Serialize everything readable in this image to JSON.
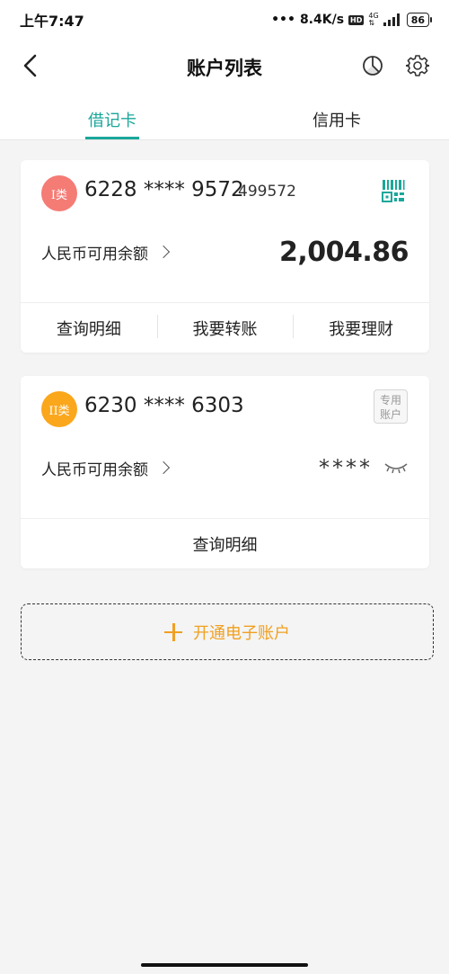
{
  "status_bar": {
    "time": "上午7:47",
    "network_speed": "8.4K/s",
    "hd": "HD",
    "network": "4G",
    "battery": "86"
  },
  "header": {
    "title": "账户列表"
  },
  "tabs": [
    {
      "label": "借记卡",
      "active": true
    },
    {
      "label": "信用卡",
      "active": false
    }
  ],
  "accounts": [
    {
      "class_label": "I类",
      "card_number": "6228 **** 9572",
      "card_suffix": "499572",
      "balance_label": "人民币可用余额",
      "balance": "2,004.86",
      "actions": [
        "查询明细",
        "我要转账",
        "我要理财"
      ]
    },
    {
      "class_label": "II类",
      "card_number": "6230 **** 6303",
      "tag": "专用账户",
      "balance_label": "人民币可用余额",
      "balance_masked": "****",
      "actions": [
        "查询明细"
      ]
    }
  ],
  "open_account": {
    "label": "开通电子账户"
  },
  "colors": {
    "accent": "#1aa79a",
    "orange": "#f0a020",
    "badge_class1": "#f57b75",
    "badge_class2": "#fba71c"
  },
  "icons": [
    "back-arrow-icon",
    "pie-chart-icon",
    "gear-icon",
    "qr-code-icon",
    "eye-closed-icon",
    "plus-icon"
  ]
}
